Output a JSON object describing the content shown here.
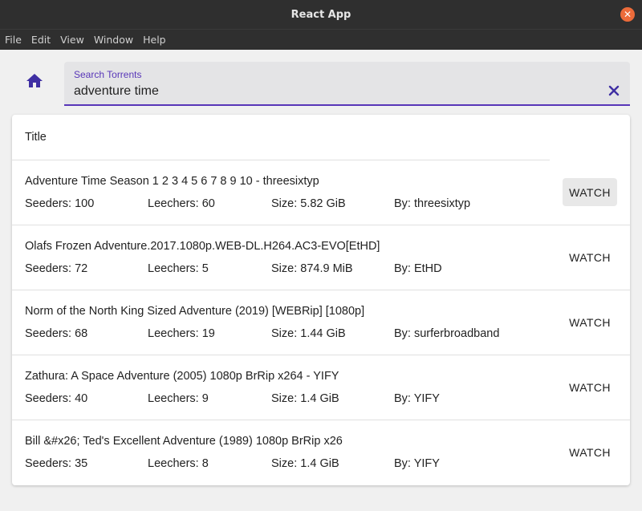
{
  "window": {
    "title": "React App"
  },
  "menu": [
    "File",
    "Edit",
    "View",
    "Window",
    "Help"
  ],
  "search": {
    "label": "Search Torrents",
    "value": "adventure time"
  },
  "table": {
    "header": "Title",
    "watch_label": "WATCH",
    "rows": [
      {
        "title": "Adventure Time Season 1 2 3 4 5 6 7 8 9 10 - threesixtyp",
        "seeders": "Seeders: 100",
        "leechers": "Leechers: 60",
        "size": "Size: 5.82 GiB",
        "by": "By: threesixtyp"
      },
      {
        "title": "Olafs Frozen Adventure.2017.1080p.WEB-DL.H264.AC3-EVO[EtHD]",
        "seeders": "Seeders: 72",
        "leechers": "Leechers: 5",
        "size": "Size: 874.9 MiB",
        "by": "By: EtHD"
      },
      {
        "title": "Norm of the North King Sized Adventure (2019) [WEBRip] [1080p]",
        "seeders": "Seeders: 68",
        "leechers": "Leechers: 19",
        "size": "Size: 1.44 GiB",
        "by": "By: surferbroadband"
      },
      {
        "title": "Zathura: A Space Adventure (2005) 1080p BrRip x264 - YIFY",
        "seeders": "Seeders: 40",
        "leechers": "Leechers: 9",
        "size": "Size: 1.4 GiB",
        "by": "By: YIFY"
      },
      {
        "title": "Bill &#x26; Ted's Excellent Adventure (1989) 1080p BrRip x26",
        "seeders": "Seeders: 35",
        "leechers": "Leechers: 8",
        "size": "Size: 1.4 GiB",
        "by": "By: YIFY"
      }
    ]
  },
  "colors": {
    "accent": "#5836b8",
    "home_icon": "#3f2fa3",
    "close": "#ec6b3a",
    "titlebar": "#2f2f2f"
  }
}
